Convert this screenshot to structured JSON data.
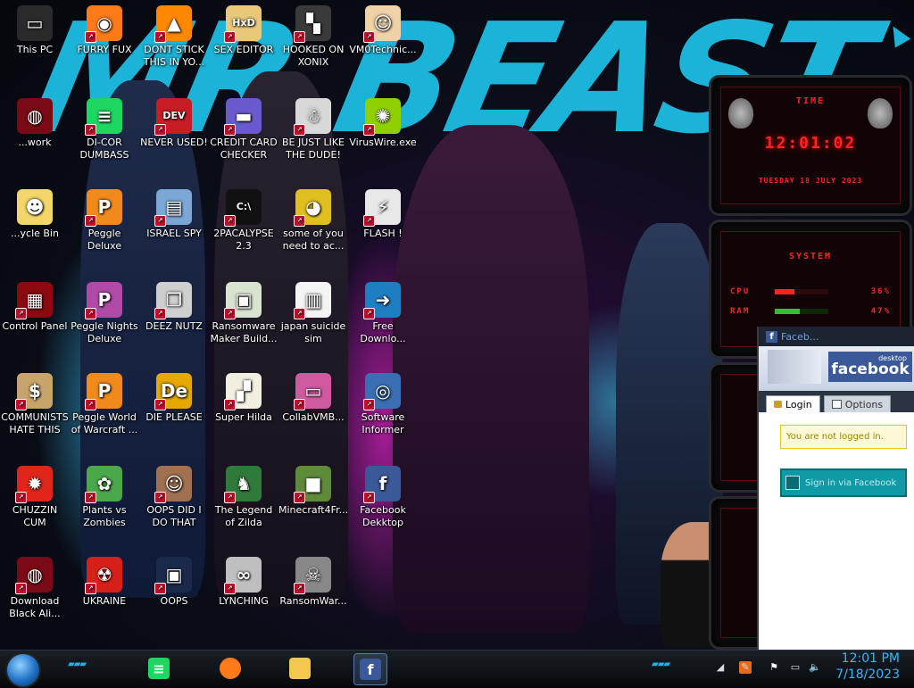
{
  "desktop_icons": [
    {
      "label": "This PC",
      "icon": "computer-icon",
      "bg": "#2a2a2a",
      "glyph": "▭"
    },
    {
      "label": "FURRY FUX",
      "icon": "firefox-icon",
      "bg": "#ff7a18",
      "glyph": "◉"
    },
    {
      "label": "DONT STICK THIS IN YO...",
      "icon": "vlc-cone-icon",
      "bg": "#ff8800",
      "glyph": "▲"
    },
    {
      "label": "SEX EDITOR",
      "icon": "hxd-editor-icon",
      "bg": "#e8c97a",
      "glyph": "HxD"
    },
    {
      "label": "HOOKED ON XONIX",
      "icon": "xonix-game-icon",
      "bg": "#3a3a3a",
      "glyph": "▚"
    },
    {
      "label": "VM0Technic...",
      "icon": "doctor-person-icon",
      "bg": "#f0d2a8",
      "glyph": "☺"
    },
    {
      "label": "...work",
      "icon": "alienware-head-icon",
      "bg": "#7a0a14",
      "glyph": "◍"
    },
    {
      "label": "DI-COR DUMBASS",
      "icon": "spotify-green-icon",
      "bg": "#1ed760",
      "glyph": "≡"
    },
    {
      "label": "NEVER USED!",
      "icon": "dev-plus-icon",
      "bg": "#c81d25",
      "glyph": "DEV"
    },
    {
      "label": "CREDIT CARD CHECKER",
      "icon": "credit-card-icon",
      "bg": "#6a5acd",
      "glyph": "▬"
    },
    {
      "label": "BE JUST LIKE THE DUDE!",
      "icon": "santa-face-icon",
      "bg": "#d8d8d8",
      "glyph": "☃"
    },
    {
      "label": "VirusWire.exe",
      "icon": "lime-icon",
      "bg": "#8fd100",
      "glyph": "✺"
    },
    {
      "label": "...ycle Bin",
      "icon": "cartoon-girl-icon",
      "bg": "#f2d66a",
      "glyph": "☻"
    },
    {
      "label": "Peggle Deluxe",
      "icon": "peggle-icon",
      "bg": "#f08a1c",
      "glyph": "P"
    },
    {
      "label": "ISRAEL SPY",
      "icon": "network-pc-icon",
      "bg": "#7aa7d6",
      "glyph": "▤"
    },
    {
      "label": "2PACALYPSE 2.3",
      "icon": "terminal-icon",
      "bg": "#111111",
      "glyph": "C:\\"
    },
    {
      "label": "some of you need to ac...",
      "icon": "beaver-icon",
      "bg": "#e0c020",
      "glyph": "◕"
    },
    {
      "label": "FLASH !",
      "icon": "flash-file-icon",
      "bg": "#e8e8e8",
      "glyph": "⚡"
    },
    {
      "label": "Control Panel",
      "icon": "control-panel-icon",
      "bg": "#8a0a10",
      "glyph": "▦"
    },
    {
      "label": "Peggle Nights Deluxe",
      "icon": "peggle-icon",
      "bg": "#b04aa8",
      "glyph": "P"
    },
    {
      "label": "DEEZ NUTZ",
      "icon": "stacked-windows-icon",
      "bg": "#cfcfcf",
      "glyph": "❐"
    },
    {
      "label": "Ransomware Maker Build...",
      "icon": "app-window-icon",
      "bg": "#d8e4d0",
      "glyph": "▣"
    },
    {
      "label": "japan suicide sim",
      "icon": "document-icon",
      "bg": "#f4f4f4",
      "glyph": "▥"
    },
    {
      "label": "Free Downlo...",
      "icon": "download-arrow-icon",
      "bg": "#1f7ec2",
      "glyph": "➜"
    },
    {
      "label": "COMMUNISTS HATE THIS G...",
      "icon": "money-bag-icon",
      "bg": "#c9a46a",
      "glyph": "$"
    },
    {
      "label": "Peggle World of Warcraft ...",
      "icon": "peggle-icon",
      "bg": "#f08a1c",
      "glyph": "P"
    },
    {
      "label": "DIE PLEASE",
      "icon": "de-logo-icon",
      "bg": "#e5a800",
      "glyph": "De"
    },
    {
      "label": "Super Hilda",
      "icon": "pixel-art-icon",
      "bg": "#f2efe0",
      "glyph": "▞"
    },
    {
      "label": "CollabVMB...",
      "icon": "monitor-pink-icon",
      "bg": "#d05aa0",
      "glyph": "▭"
    },
    {
      "label": "Software Informer",
      "icon": "magnifier-icon",
      "bg": "#3a6fb4",
      "glyph": "◎"
    },
    {
      "label": "CHUZZIN CUM",
      "icon": "chuzzle-icon",
      "bg": "#e0261b",
      "glyph": "✹"
    },
    {
      "label": "Plants vs Zombies",
      "icon": "flower-icon",
      "bg": "#4aa84a",
      "glyph": "✿"
    },
    {
      "label": "OOPS DID I DO THAT",
      "icon": "portrait-icon",
      "bg": "#a07050",
      "glyph": "☺"
    },
    {
      "label": "The Legend of Zilda",
      "icon": "pixel-hero-icon",
      "bg": "#2f7a3a",
      "glyph": "♞"
    },
    {
      "label": "Minecraft4Fr...",
      "icon": "grass-block-icon",
      "bg": "#5f8a3a",
      "glyph": "■"
    },
    {
      "label": "Facebook Dekktop",
      "icon": "facebook-icon",
      "bg": "#3b5998",
      "glyph": "f"
    },
    {
      "label": "Download Black Ali...",
      "icon": "alienware-head-icon",
      "bg": "#7a0a14",
      "glyph": "◍"
    },
    {
      "label": "UKRAINE",
      "icon": "radiation-icon",
      "bg": "#d8201a",
      "glyph": "☢"
    },
    {
      "label": "OOPS",
      "icon": "pc-crash-icon",
      "bg": "#1a2a4a",
      "glyph": "▣"
    },
    {
      "label": "LYNCHING",
      "icon": "rope-knot-icon",
      "bg": "#bfbfbf",
      "glyph": "∞"
    },
    {
      "label": "RansomWar...",
      "icon": "skull-icon",
      "bg": "#888888",
      "glyph": "☠"
    }
  ],
  "wallpaper": {
    "headline": "MR BEAST"
  },
  "gadgets": {
    "time_title": "TIME",
    "time": "12:01:02",
    "date": "TUESDAY 18 JULY 2023",
    "system_title": "SYSTEM",
    "cpu_label": "CPU",
    "cpu_value": "36%",
    "ram_label": "RAM",
    "ram_value": "47%",
    "cpu_fraction": 0.36,
    "ram_fraction": 0.47
  },
  "facebook_window": {
    "title": "Faceb...",
    "logo_tag": "desktop",
    "logo_text": "facebook",
    "tab_login": "Login",
    "tab_options": "Options",
    "notice": "You are not logged in.",
    "signin_button": "Sign in via Facebook"
  },
  "taskbar": {
    "pinned": [
      {
        "name": "spotify-taskbar-button",
        "icon": "spotify-icon",
        "color": "#1ed760"
      },
      {
        "name": "firefox-taskbar-button",
        "icon": "firefox-icon",
        "color": "#ff7a18"
      },
      {
        "name": "file-explorer-taskbar-button",
        "icon": "folder-icon",
        "color": "#f2c94c"
      },
      {
        "name": "facebook-taskbar-button",
        "icon": "facebook-icon",
        "color": "#3b5998"
      }
    ],
    "clock_time": "12:01 PM",
    "clock_date": "7/18/2023"
  },
  "colors": {
    "accent_cyan": "#1bb4d8",
    "alien_red": "#ff2424",
    "facebook_blue": "#3b5998",
    "clock_blue": "#2fb8ff"
  }
}
